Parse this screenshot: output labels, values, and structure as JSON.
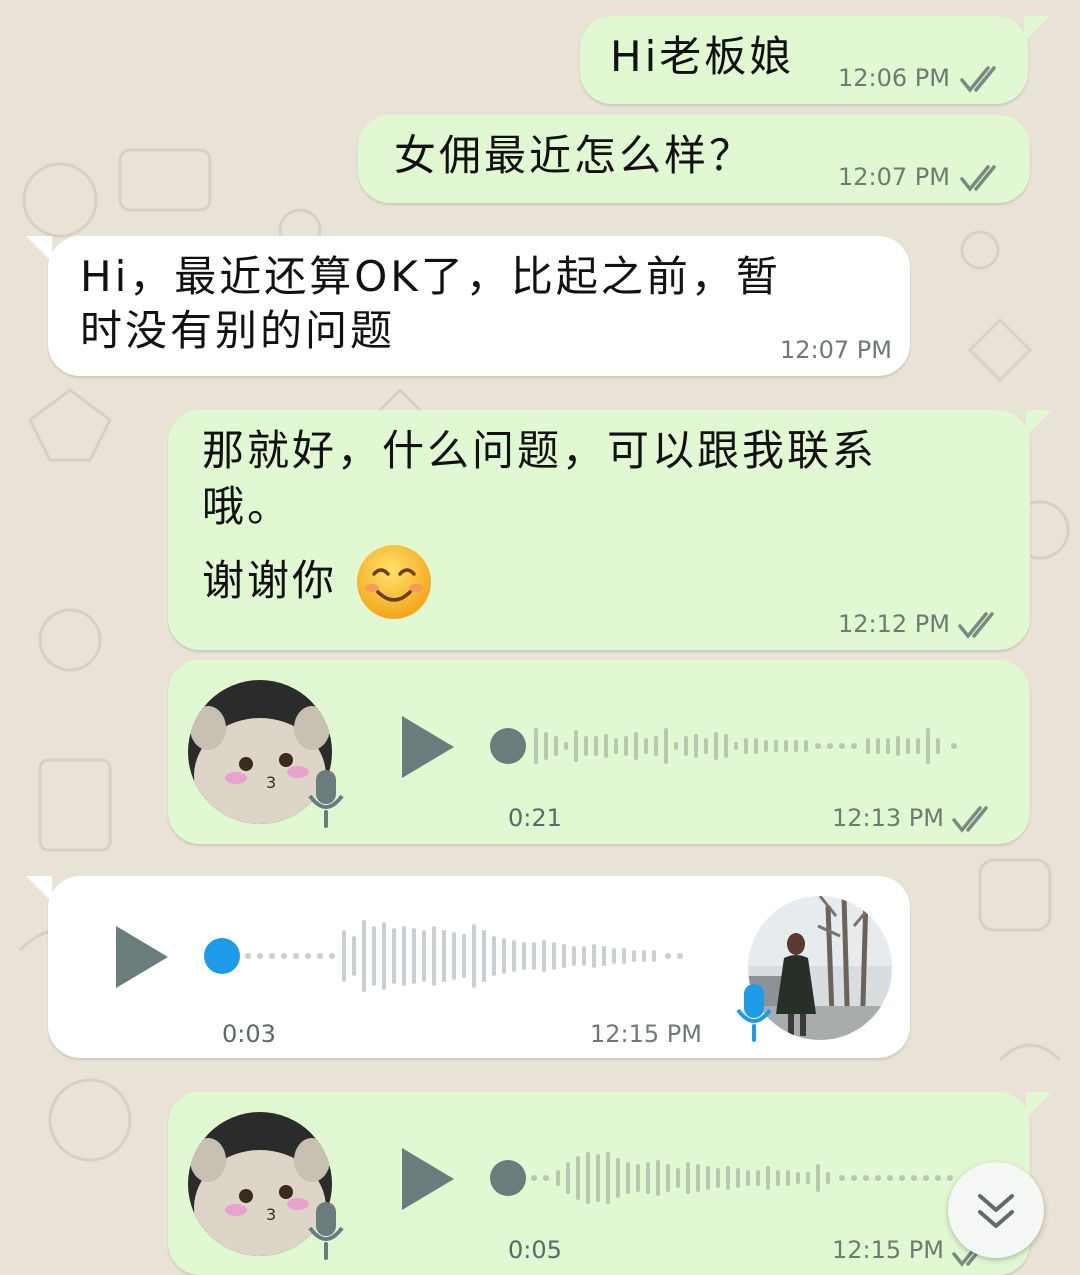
{
  "theme": {
    "outgoing_bg": "#e2f8d2",
    "incoming_bg": "#ffffff",
    "wallpaper_bg": "#e9e2d6",
    "ticks_color": "#7b8a80",
    "voice_accent_in": "#1e9be8",
    "voice_accent_out": "#6a7c7b"
  },
  "messages": [
    {
      "type": "text",
      "direction": "out",
      "text": "Hi老板娘",
      "time": "12:06 PM",
      "status": "read"
    },
    {
      "type": "text",
      "direction": "out",
      "text": "女佣最近怎么样？",
      "time": "12:07 PM",
      "status": "read"
    },
    {
      "type": "text",
      "direction": "in",
      "lines": [
        "Hi，最近还算OK了，比起之前，暂",
        "时没有别的问题"
      ],
      "time": "12:07 PM"
    },
    {
      "type": "text",
      "direction": "out",
      "lines": [
        "那就好，什么问题，可以跟我联系",
        "哦。",
        "谢谢你"
      ],
      "emoji": "smiling-face-emoji",
      "time": "12:12 PM",
      "status": "read"
    },
    {
      "type": "voice",
      "direction": "out",
      "duration": "0:21",
      "time": "12:13 PM",
      "status": "read",
      "avatar": "plush-toy-avatar"
    },
    {
      "type": "voice",
      "direction": "in",
      "duration": "0:03",
      "time": "12:15 PM",
      "avatar": "woman-street-avatar"
    },
    {
      "type": "voice",
      "direction": "out",
      "duration": "0:05",
      "time": "12:15 PM",
      "status": "read",
      "avatar": "plush-toy-avatar"
    }
  ],
  "scroll_button": {
    "icon": "double-chevron-down-icon"
  }
}
